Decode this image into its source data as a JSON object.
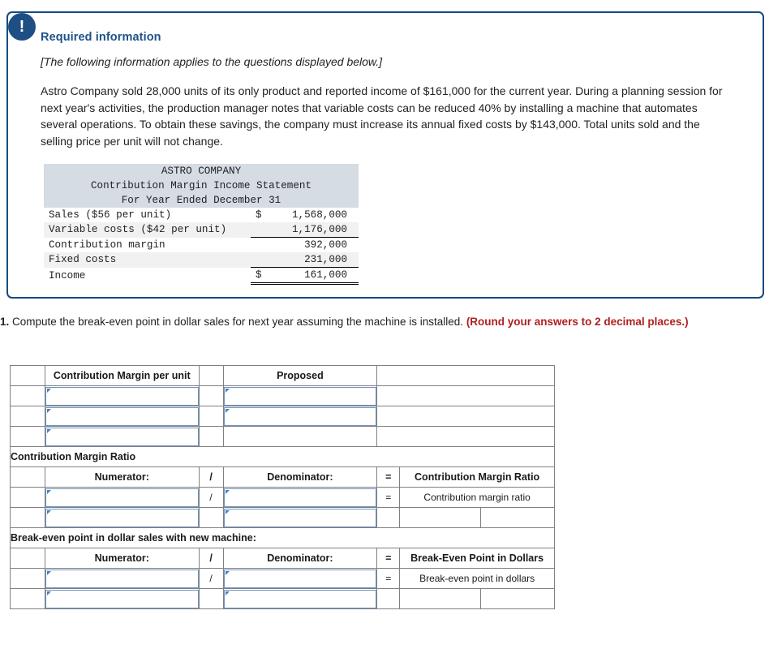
{
  "callout": {
    "icon": "exclamation-icon",
    "title": "Required information",
    "note": "[The following information applies to the questions displayed below.]",
    "paragraph": "Astro Company sold 28,000 units of its only product and reported income of $161,000 for the current year. During a planning session for next year's activities, the production manager notes that variable costs can be reduced 40% by installing a machine that automates several operations. To obtain these savings, the company must increase its annual fixed costs by $143,000. Total units sold and the selling price per unit will not change."
  },
  "statement": {
    "company": "ASTRO COMPANY",
    "title": "Contribution Margin Income Statement",
    "period": "For Year Ended December 31",
    "rows": [
      {
        "label": "Sales ($56 per unit)",
        "currency": "$",
        "amount": "1,568,000"
      },
      {
        "label": "Variable costs ($42 per unit)",
        "currency": "",
        "amount": "1,176,000"
      },
      {
        "label": "Contribution margin",
        "currency": "",
        "amount": "392,000"
      },
      {
        "label": "Fixed costs",
        "currency": "",
        "amount": "231,000"
      },
      {
        "label": "Income",
        "currency": "$",
        "amount": "161,000"
      }
    ]
  },
  "question": {
    "number": "1.",
    "text": " Compute the break-even point in dollar sales for next year assuming the machine is installed. ",
    "instruction": "(Round your answers to 2 decimal places.)"
  },
  "grid": {
    "section1": {
      "header_col2": "Contribution Margin per unit",
      "header_col4": "Proposed"
    },
    "section2": {
      "title": "Contribution Margin Ratio",
      "numerator": "Numerator:",
      "divider": "/",
      "denominator": "Denominator:",
      "equals": "=",
      "result_header": "Contribution Margin Ratio",
      "result_label": "Contribution margin ratio"
    },
    "section3": {
      "title": "Break-even point in dollar sales with new machine:",
      "numerator": "Numerator:",
      "divider": "/",
      "denominator": "Denominator:",
      "equals": "=",
      "result_header": "Break-Even Point in Dollars",
      "result_label": "Break-even point in dollars"
    }
  },
  "colors": {
    "header_blue": "#80a9dc",
    "callout_border": "#144a80",
    "callout_title": "#1f5286",
    "instruction_red": "#b02020",
    "answer_yellow": "#fdfbb0",
    "statement_header_bg": "#d5dce4"
  }
}
